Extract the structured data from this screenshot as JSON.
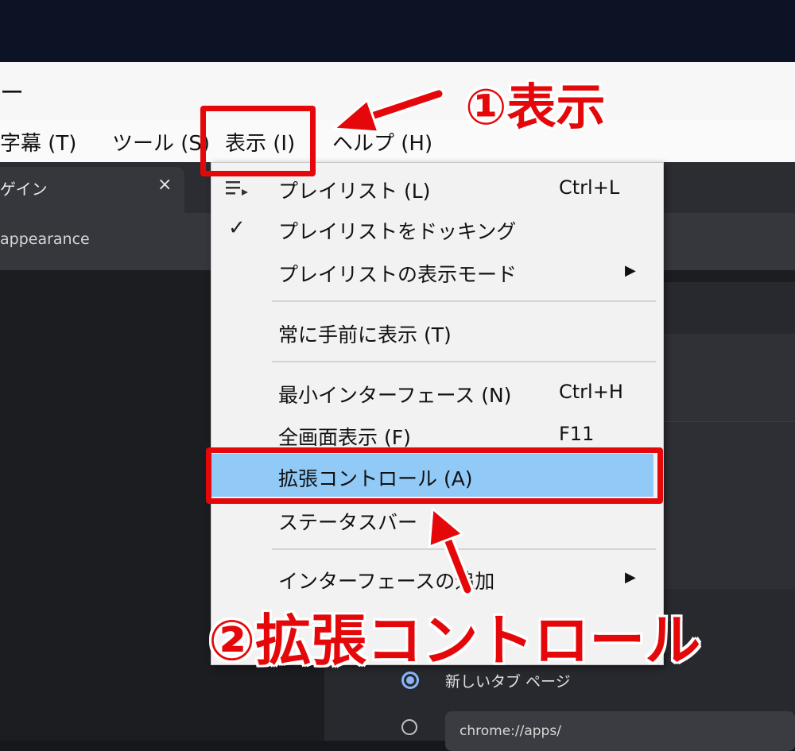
{
  "window": {
    "title": "ー"
  },
  "menubar": {
    "items": [
      {
        "label": "字幕 (T)"
      },
      {
        "label": "ツール (S)"
      },
      {
        "label": "表示 (I)"
      },
      {
        "label": "ヘルプ (H)"
      }
    ]
  },
  "browser": {
    "tab_title": "ゲイン",
    "tab_close": "×",
    "address_text": "appearance",
    "settings": {
      "radio1_label": "新しいタブ ページ",
      "url_value": "chrome://apps/"
    }
  },
  "dropdown": {
    "items": [
      {
        "label": "プレイリスト (L)",
        "shortcut": "Ctrl+L"
      },
      {
        "label": "プレイリストをドッキング",
        "checked": true
      },
      {
        "label": "プレイリストの表示モード",
        "submenu": "▶"
      },
      {
        "label": "常に手前に表示 (T)"
      },
      {
        "label": "最小インターフェース (N)",
        "shortcut": "Ctrl+H"
      },
      {
        "label": "全画面表示 (F)",
        "shortcut": "F11"
      },
      {
        "label": "拡張コントロール (A)",
        "highlighted": true
      },
      {
        "label": "ステータスバー"
      },
      {
        "label": "インターフェースの追加",
        "submenu": "▶"
      }
    ],
    "check_icon": "✓"
  },
  "annotations": {
    "label1": "①表示",
    "label2": "②拡張コントロール",
    "color": "#e4080a"
  },
  "colors": {
    "highlight": "#91c9f7",
    "menu_bg": "#f2f2f2"
  }
}
